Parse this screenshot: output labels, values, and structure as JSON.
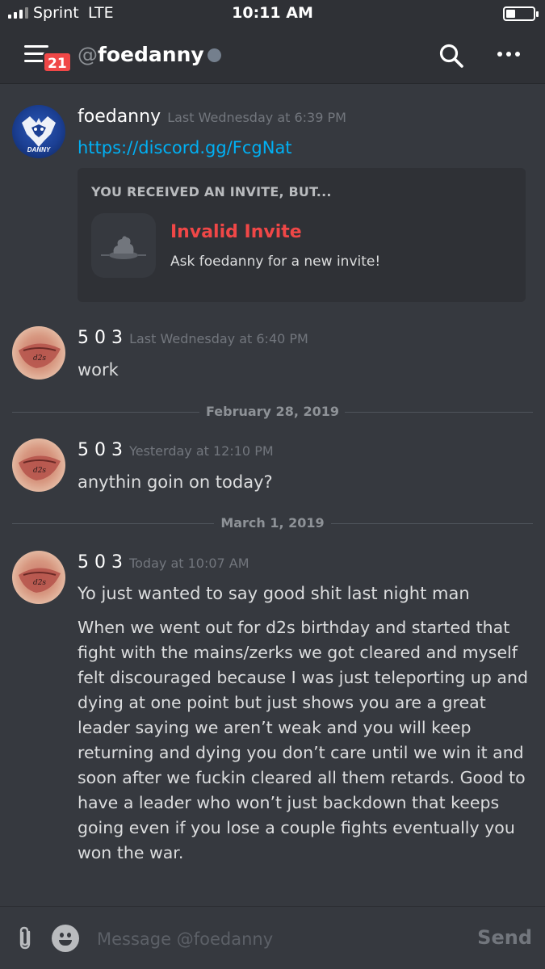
{
  "status_bar": {
    "carrier": "Sprint",
    "network": "LTE",
    "time": "10:11 AM",
    "battery_level": 0.35
  },
  "header": {
    "menu_badge": "21",
    "at_symbol": "@",
    "channel_name": "foedanny",
    "status_color": "#747f8d"
  },
  "messages": [
    {
      "author": "foedanny",
      "timestamp": "Last Wednesday at 6:39 PM",
      "link": "https://discord.gg/FcgNat",
      "avatar_text": "DANNY",
      "embed": {
        "title": "YOU RECEIVED AN INVITE, BUT...",
        "heading": "Invalid Invite",
        "subtext": "Ask foedanny for a new invite!"
      }
    },
    {
      "author": "5 0 3",
      "timestamp": "Last Wednesday at 6:40 PM",
      "text": "work"
    },
    {
      "author": "5 0 3",
      "timestamp": "Yesterday at 12:10 PM",
      "text": "anythin goin on today?"
    },
    {
      "author": "5 0 3",
      "timestamp": "Today at 10:07 AM",
      "text": "Yo just wanted to say good shit last night man",
      "text2": "When we went out for d2s birthday and started that fight with the mains/zerks we got cleared and myself felt discouraged because I was just teleporting up and dying at one point but just shows you are a great leader saying we aren’t weak and you will keep returning and dying you don’t care until we win it and soon after we fuckin cleared all them retards. Good to have a leader who won’t just backdown that keeps going even if you lose a couple fights eventually you won the war."
    }
  ],
  "dividers": [
    "February 28, 2019",
    "March 1, 2019"
  ],
  "composer": {
    "placeholder": "Message @foedanny",
    "send_label": "Send"
  },
  "colors": {
    "background": "#36393f",
    "header_bg": "#2f3136",
    "link": "#00b0f4",
    "invalid_red": "#f04747",
    "timestamp": "#72767d"
  }
}
